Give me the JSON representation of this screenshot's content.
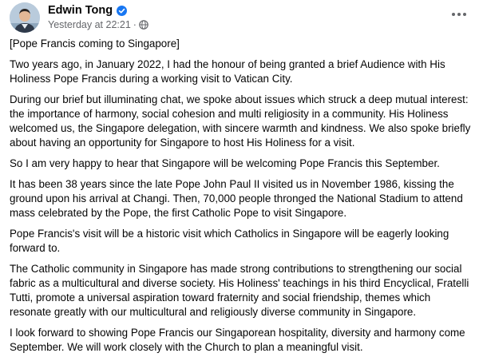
{
  "author": {
    "name": "Edwin Tong",
    "verified_icon": "verified-badge-icon",
    "timestamp": "Yesterday at 22:21",
    "audience_icon": "globe-icon"
  },
  "menu": {
    "more_icon": "more-options-icon"
  },
  "colors": {
    "verified": "#1877f2",
    "secondary_text": "#65676b",
    "primary_text": "#050505"
  },
  "post": {
    "paragraphs": [
      "[Pope Francis coming to Singapore]",
      "Two years ago, in January 2022, I had the honour of being granted a brief Audience with His Holiness Pope Francis during a working visit to Vatican City.",
      "During our brief but illuminating chat, we spoke about issues which struck a deep mutual interest: the importance of harmony, social cohesion and multi religiosity in a community.  His Holiness welcomed us, the Singapore delegation, with sincere warmth and kindness.  We also spoke briefly about having an opportunity for Singapore to host His Holiness for a visit.",
      "So I am very happy to hear that Singapore will be welcoming Pope Francis this September.",
      "It has been 38 years since the late Pope John Paul II visited us in November 1986, kissing the ground upon his arrival at Changi. Then, 70,000 people thronged the National Stadium to attend mass celebrated by the Pope, the first Catholic Pope to visit Singapore.",
      "Pope Francis's visit will be a historic visit which Catholics in Singapore will be eagerly looking forward to.",
      "The Catholic community in Singapore has made strong contributions to strengthening our social fabric as a multicultural and diverse society.  His Holiness' teachings in his third Encyclical, Fratelli Tutti, promote a universal aspiration toward fraternity and social friendship, themes which resonate greatly with our multicultural and religiously diverse community in Singapore.",
      "I look forward to showing Pope Francis our Singaporean hospitality, diversity and harmony come September.  We will work closely with the Church to plan a meaningful visit."
    ]
  }
}
